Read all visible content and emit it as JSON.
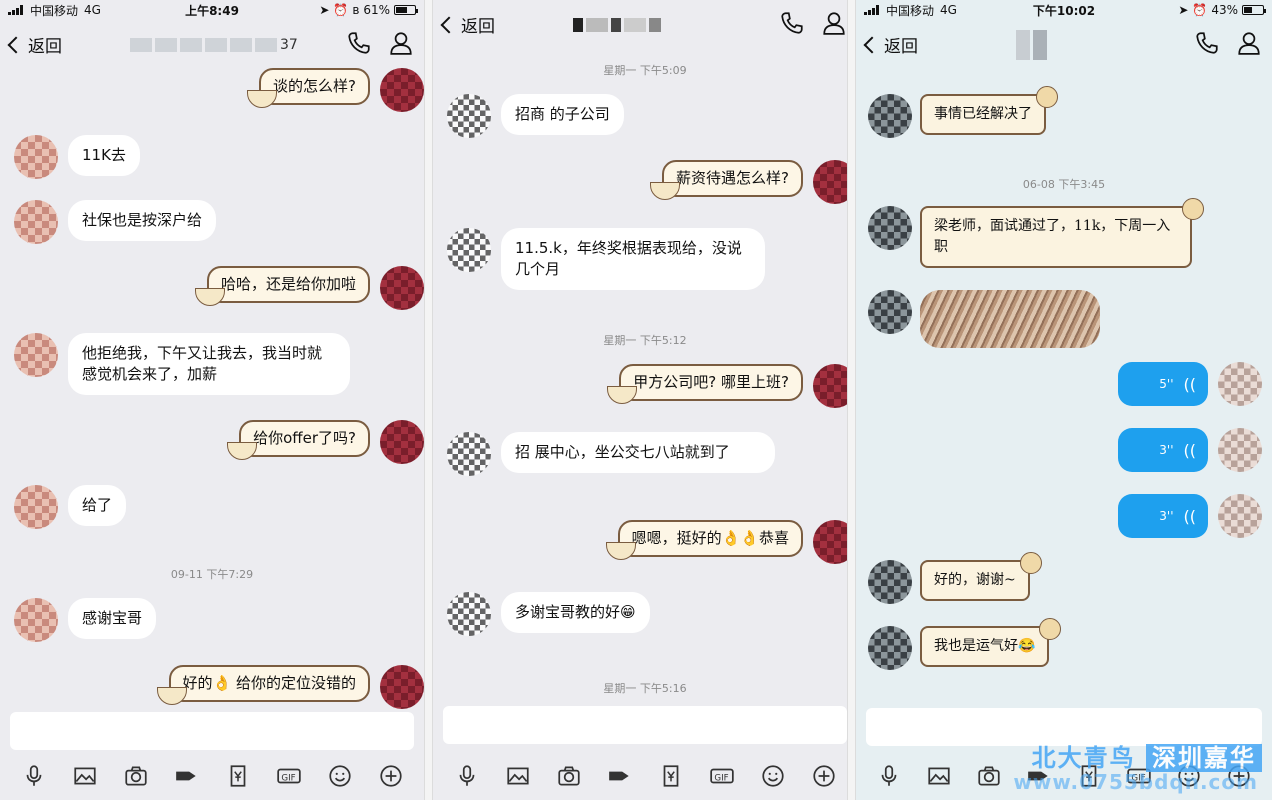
{
  "screen1": {
    "status": {
      "carrier": "中国移动",
      "network": "4G",
      "time": "上午8:49",
      "battery": "61%",
      "battery_level": 0.61
    },
    "nav": {
      "back": "返回",
      "title_tail": "37"
    },
    "timestamps": [
      "09-11 下午7:29"
    ],
    "messages": [
      {
        "side": "right",
        "text": "谈的怎么样?"
      },
      {
        "side": "left",
        "text": "11K去"
      },
      {
        "side": "left",
        "text": "社保也是按深户给"
      },
      {
        "side": "right",
        "text": "哈哈，还是给你加啦"
      },
      {
        "side": "left",
        "text": "他拒绝我，下午又让我去，我当时就感觉机会来了，加薪"
      },
      {
        "side": "right",
        "text": "给你offer了吗?"
      },
      {
        "side": "left",
        "text": "给了"
      },
      {
        "side": "left",
        "text": "感谢宝哥"
      },
      {
        "side": "right",
        "text": "好的👌 给你的定位没错的"
      }
    ]
  },
  "screen2": {
    "nav": {
      "back": "返回"
    },
    "timestamps": [
      "星期一 下午5:09",
      "星期一 下午5:12",
      "星期一 下午5:16"
    ],
    "messages": [
      {
        "side": "left",
        "text": "招商    的子公司"
      },
      {
        "side": "right",
        "text": "薪资待遇怎么样?"
      },
      {
        "side": "left",
        "text": "11.5.k，年终奖根据表现给，没说几个月"
      },
      {
        "side": "right",
        "text": "甲方公司吧? 哪里上班?"
      },
      {
        "side": "left",
        "text": "招     展中心，坐公交七八站就到了"
      },
      {
        "side": "right",
        "text": "嗯嗯，挺好的👌👌恭喜"
      },
      {
        "side": "left",
        "text": "多谢宝哥教的好😁"
      }
    ]
  },
  "screen3": {
    "status": {
      "carrier": "中国移动",
      "network": "4G",
      "time": "下午10:02",
      "battery": "43%",
      "battery_level": 0.43
    },
    "nav": {
      "back": "返回"
    },
    "timestamps": [
      "06-08 下午3:45"
    ],
    "messages": [
      {
        "side": "left",
        "text": "事情已经解决了"
      },
      {
        "side": "left",
        "text": "梁老师，面试通过了，11k，下周一入职"
      },
      {
        "side": "right",
        "voice": "5''"
      },
      {
        "side": "right",
        "voice": "3''"
      },
      {
        "side": "right",
        "voice": "3''"
      },
      {
        "side": "left",
        "text": "好的，谢谢~"
      },
      {
        "side": "left",
        "text": "我也是运气好😂"
      }
    ],
    "watermark": {
      "name_a": "北大青鸟",
      "name_b": "深圳嘉华",
      "url": "www.0755bdqn.com"
    }
  },
  "toolbar_icons": [
    "microphone-icon",
    "image-icon",
    "camera-icon",
    "red-packet-icon",
    "transfer-icon",
    "gif-icon",
    "emoji-icon",
    "plus-icon"
  ],
  "colors": {
    "voice_bubble": "#1ea0ee",
    "theme_border": "#7a5c40",
    "bg_chat": "#ececf0",
    "bg_chat_3": "#e6eff2"
  }
}
